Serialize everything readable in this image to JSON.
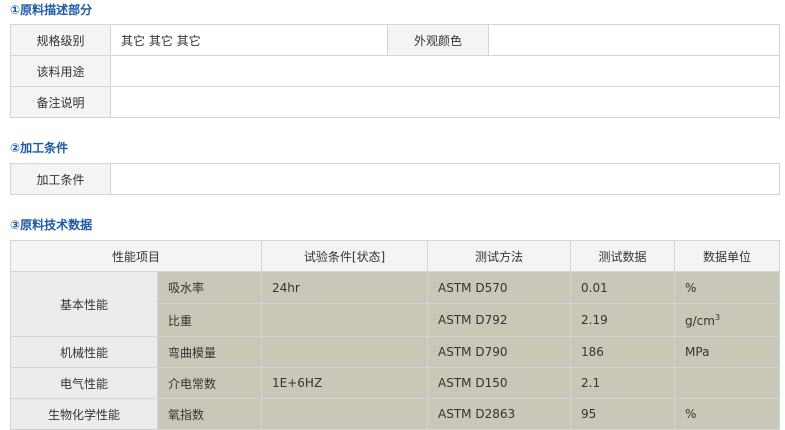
{
  "section1": {
    "title": "①原料描述部分",
    "spec_label": "规格级别",
    "spec_value": "其它 其它 其它",
    "appearance_label": "外观颜色",
    "appearance_value": "",
    "usage_label": "该料用途",
    "usage_value": "",
    "notes_label": "备注说明",
    "notes_value": ""
  },
  "section2": {
    "title": "②加工条件",
    "process_label": "加工条件",
    "process_value": ""
  },
  "section3": {
    "title": "③原料技术数据",
    "headers": [
      "性能项目",
      "试验条件[状态]",
      "测试方法",
      "测试数据",
      "数据单位"
    ],
    "groups": {
      "basic": "基本性能",
      "mechanical": "机械性能",
      "electrical": "电气性能",
      "biochem": "生物化学性能"
    },
    "rows": [
      {
        "property": "吸水率",
        "condition": "24hr",
        "method": "ASTM D570",
        "value": "0.01",
        "unit": "%"
      },
      {
        "property": "比重",
        "condition": "",
        "method": "ASTM D792",
        "value": "2.19",
        "unit_base": "g/cm",
        "unit_sup": "3"
      },
      {
        "property": "弯曲模量",
        "condition": "",
        "method": "ASTM D790",
        "value": "186",
        "unit": "MPa"
      },
      {
        "property": "介电常数",
        "condition": "1E+6HZ",
        "method": "ASTM D150",
        "value": "2.1",
        "unit": ""
      },
      {
        "property": "氧指数",
        "condition": "",
        "method": "ASTM D2863",
        "value": "95",
        "unit": "%"
      }
    ]
  }
}
